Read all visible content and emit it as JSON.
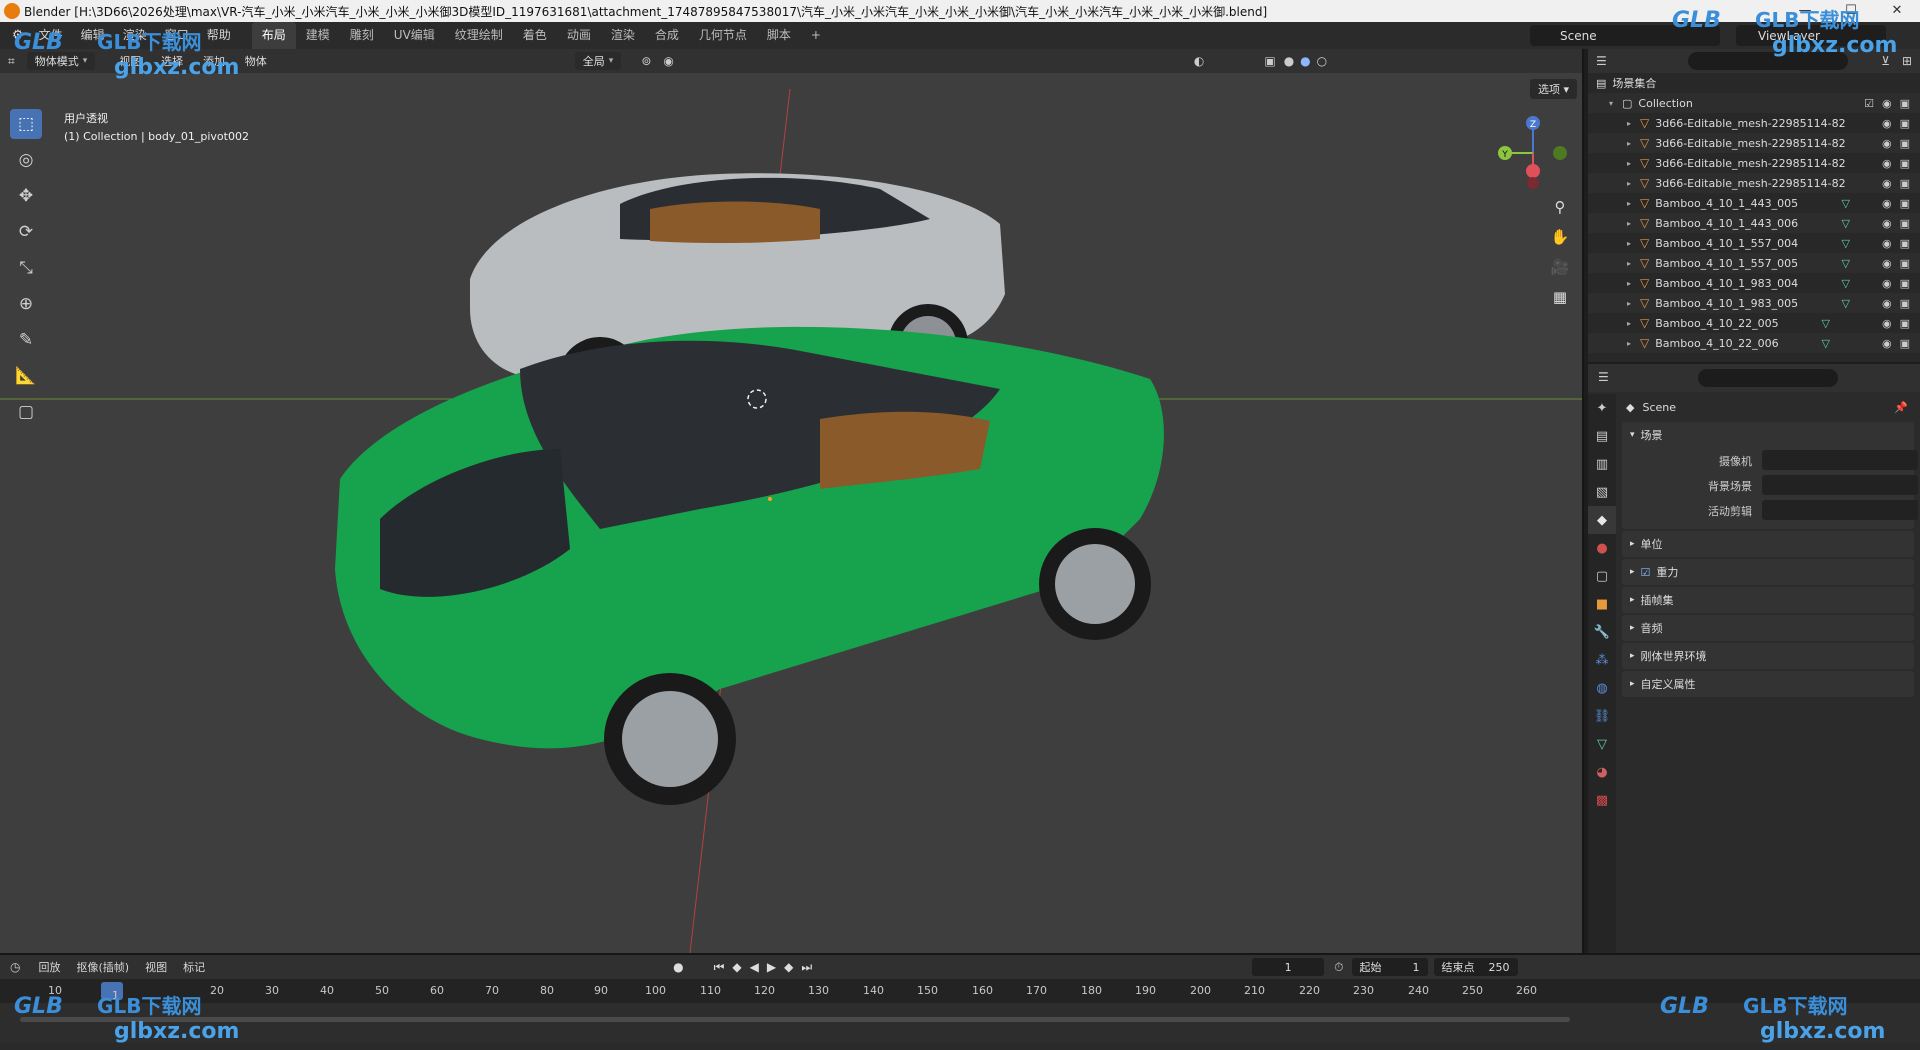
{
  "window_title": "Blender [H:\\3D66\\2026处理\\max\\VR-汽车_小米_小米汽车_小米_小米_小米御3D模型ID_1197631681\\attachment_17487895847538017\\汽车_小米_小米汽车_小米_小米_小米御\\汽车_小米_小米汽车_小米_小米_小米御.blend]",
  "topbar": {
    "menu": [
      "文件",
      "编辑",
      "渲染",
      "窗口",
      "帮助"
    ],
    "workspaces": [
      "布局",
      "建模",
      "雕刻",
      "UV编辑",
      "纹理绘制",
      "着色",
      "动画",
      "渲染",
      "合成",
      "几何节点",
      "脚本"
    ],
    "active_workspace": "布局",
    "add_tab": "+",
    "scene": "Scene",
    "view_layer": "ViewLayer"
  },
  "viewport": {
    "mode": "物体模式",
    "menu": [
      "视图",
      "选择",
      "添加",
      "物体"
    ],
    "orientation": "全局",
    "options": "选项",
    "view_name": "用户透视",
    "collection_info": "(1) Collection | body_01_pivot002",
    "axis_labels": {
      "x": "X",
      "y": "Y",
      "z": "Z"
    }
  },
  "outliner": {
    "root": "场景集合",
    "collection": "Collection",
    "items": [
      "3d66-Editable_mesh-22985114-82",
      "3d66-Editable_mesh-22985114-82",
      "3d66-Editable_mesh-22985114-82",
      "3d66-Editable_mesh-22985114-82",
      "Bamboo_4_10_1_443_005",
      "Bamboo_4_10_1_443_006",
      "Bamboo_4_10_1_557_004",
      "Bamboo_4_10_1_557_005",
      "Bamboo_4_10_1_983_004",
      "Bamboo_4_10_1_983_005",
      "Bamboo_4_10_22_005",
      "Bamboo_4_10_22_006"
    ]
  },
  "properties": {
    "title": "Scene",
    "section": "场景",
    "fields": [
      {
        "label": "摄像机",
        "value": ""
      },
      {
        "label": "背景场景",
        "value": ""
      },
      {
        "label": "活动剪辑",
        "value": ""
      }
    ],
    "panels": [
      "单位",
      "重力",
      "插帧集",
      "音频",
      "刚体世界环境",
      "自定义属性"
    ]
  },
  "timeline": {
    "menu": [
      "回放",
      "抠像(插帧)",
      "视图",
      "标记"
    ],
    "current_frame": "1",
    "start_label": "起始",
    "start": "1",
    "end_label": "结束点",
    "end": "250",
    "ruler": [
      "10",
      "20",
      "30",
      "40",
      "50",
      "60",
      "70",
      "80",
      "90",
      "100",
      "110",
      "120",
      "130",
      "140",
      "150",
      "160",
      "170",
      "180",
      "190",
      "200",
      "210",
      "220",
      "230",
      "240",
      "250",
      "260"
    ],
    "playhead": "1"
  },
  "watermark": {
    "brand": "GLB",
    "text": "GLB下载网",
    "url": "glbxz.com"
  }
}
